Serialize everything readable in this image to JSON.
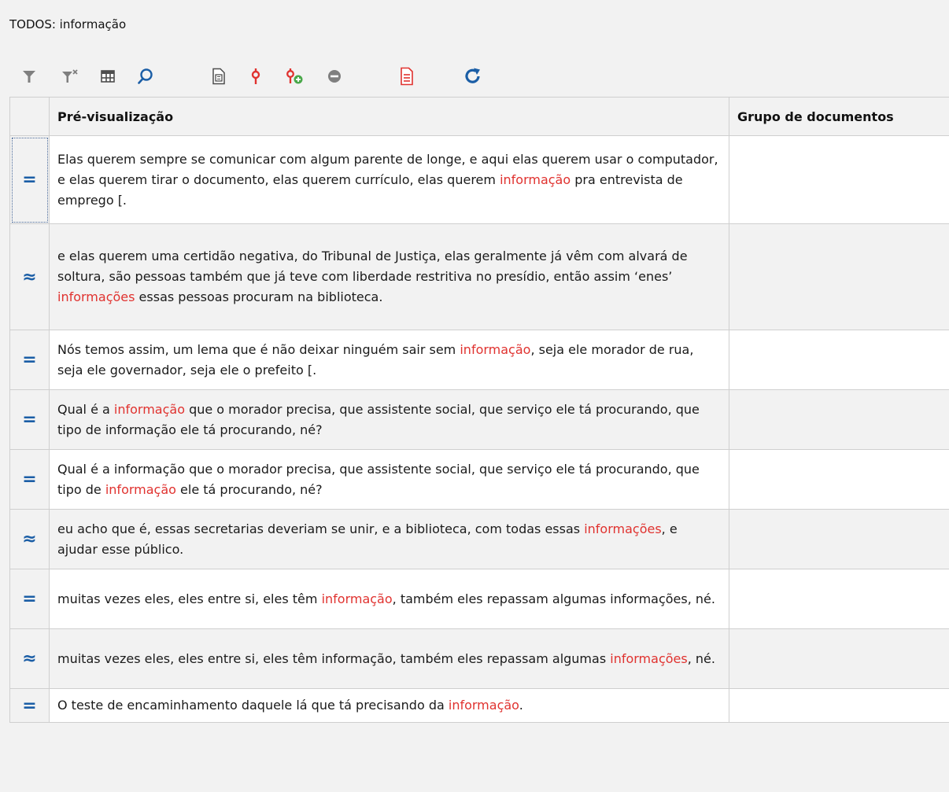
{
  "window": {
    "title": "TODOS: informação"
  },
  "toolbar": {
    "icons": [
      "filter-icon",
      "clear-filter-icon",
      "columns-icon",
      "search-icon",
      "document-icon",
      "code-icon",
      "add-code-icon",
      "remove-icon",
      "report-icon",
      "refresh-icon"
    ]
  },
  "colors": {
    "accent": "#1b5ea6",
    "highlight": "#e0322f",
    "toolbar_red": "#e0322f"
  },
  "table": {
    "columns": [
      "Pré-visualização",
      "Grupo de documentos"
    ],
    "rows": [
      {
        "symbol": "=",
        "selected": true,
        "parts": [
          "Elas querem sempre se comunicar com algum parente de longe, e aqui elas querem usar o computador, e elas querem tirar o documento, elas querem currículo, elas querem ",
          "informação",
          " pra entrevista de emprego [."
        ],
        "group": ""
      },
      {
        "symbol": "≈",
        "parts": [
          "e elas querem uma certidão negativa, do Tribunal de Justiça, elas geralmente já vêm com alvará de soltura, são pessoas também que já teve com liberdade restritiva no presídio, então assim ‘enes’ ",
          "informações",
          " essas pessoas procuram na biblioteca."
        ],
        "group": ""
      },
      {
        "symbol": "=",
        "parts": [
          "Nós temos assim, um lema que é não deixar ninguém sair sem ",
          "informação",
          ", seja ele morador de rua, seja ele governador, seja ele o prefeito [."
        ],
        "group": ""
      },
      {
        "symbol": "=",
        "parts": [
          "Qual é a ",
          "informação",
          " que o morador precisa, que assistente social, que serviço ele tá procurando, que tipo de informação ele tá procurando, né?"
        ],
        "group": ""
      },
      {
        "symbol": "=",
        "parts": [
          "Qual é a informação que o morador precisa, que assistente social, que serviço ele tá procurando, que tipo de ",
          "informação",
          " ele tá procurando, né?"
        ],
        "group": ""
      },
      {
        "symbol": "≈",
        "parts": [
          "eu acho que é, essas secretarias deveriam se unir, e a biblioteca, com todas essas ",
          "informações",
          ", e ajudar esse público."
        ],
        "group": ""
      },
      {
        "symbol": "=",
        "parts": [
          "muitas vezes eles, eles entre si, eles têm ",
          "informação",
          ", também eles repassam algumas informações, né."
        ],
        "group": ""
      },
      {
        "symbol": "≈",
        "parts": [
          "muitas vezes eles, eles entre si, eles têm informação, também eles repassam algumas ",
          "informações",
          ", né."
        ],
        "group": ""
      },
      {
        "symbol": "=",
        "parts": [
          "O teste de encaminhamento daquele lá que tá precisando da ",
          "informação",
          "."
        ],
        "group": ""
      }
    ]
  }
}
